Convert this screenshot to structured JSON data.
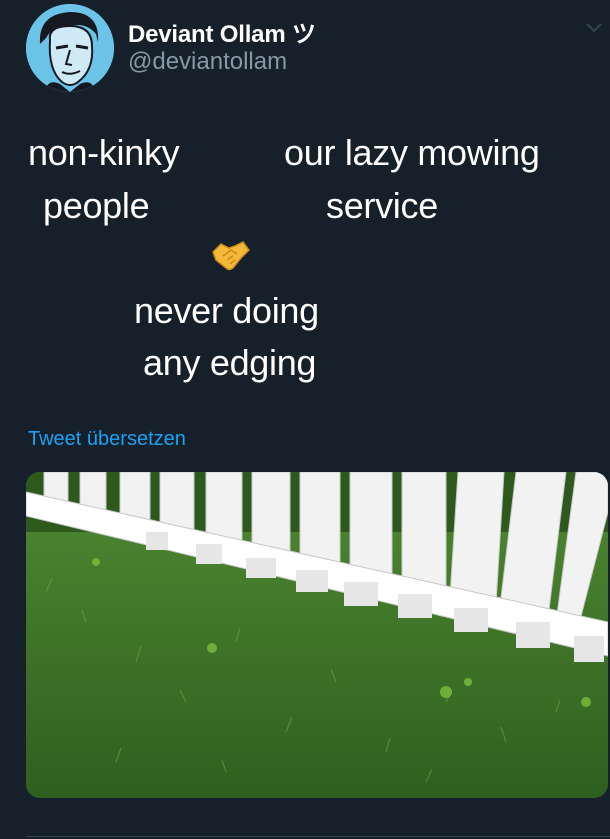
{
  "tweet": {
    "display_name": "Deviant Ollam ツ",
    "handle": "@deviantollam",
    "lines": {
      "left_1": "non-kinky",
      "left_2": "people",
      "right_1": "our lazy mowing",
      "right_2": "service",
      "center_1": "never doing",
      "center_2": "any edging"
    },
    "emoji": "handshake-emoji",
    "translate_label": "Tweet übersetzen",
    "media_subject": "white picket fence over unedged grass"
  },
  "colors": {
    "background": "#15202b",
    "link": "#1da1f2",
    "secondary_text": "#8899a6"
  }
}
